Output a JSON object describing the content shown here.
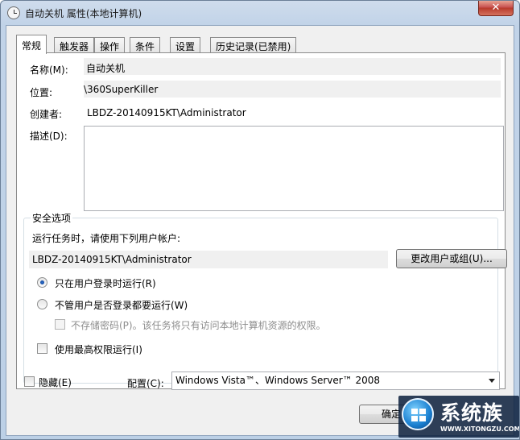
{
  "window": {
    "title": "自动关机 属性(本地计算机)",
    "close_label": "✕"
  },
  "tabs": [
    {
      "label": "常规"
    },
    {
      "label": "触发器"
    },
    {
      "label": "操作"
    },
    {
      "label": "条件"
    },
    {
      "label": "设置"
    },
    {
      "label": "历史记录(已禁用)"
    }
  ],
  "general": {
    "name_label": "名称(M):",
    "name_value": "自动关机",
    "location_label": "位置:",
    "location_value": "\\360SuperKiller",
    "author_label": "创建者:",
    "author_value": "LBDZ-20140915KT\\Administrator",
    "description_label": "描述(D):",
    "description_value": ""
  },
  "security": {
    "group_title": "安全选项",
    "run_as_prompt": "运行任务时，请使用下列用户帐户:",
    "account_value": "LBDZ-20140915KT\\Administrator",
    "change_user_button": "更改用户或组(U)...",
    "radio_logged_on": "只在用户登录时运行(R)",
    "radio_logged_on_checked": true,
    "radio_whether_logged": "不管用户是否登录都要运行(W)",
    "radio_whether_logged_checked": false,
    "no_store_password": "不存储密码(P)。该任务将只有访问本地计算机资源的权限。",
    "highest_privileges": "使用最高权限运行(I)"
  },
  "footer": {
    "hidden_label": "隐藏(E)",
    "configure_label": "配置(C):",
    "configure_value": "Windows Vista™、Windows Server™ 2008",
    "ok_button": "确定"
  },
  "watermark": {
    "title": "系统族",
    "url": "WWW.XITONGZU.COM"
  }
}
